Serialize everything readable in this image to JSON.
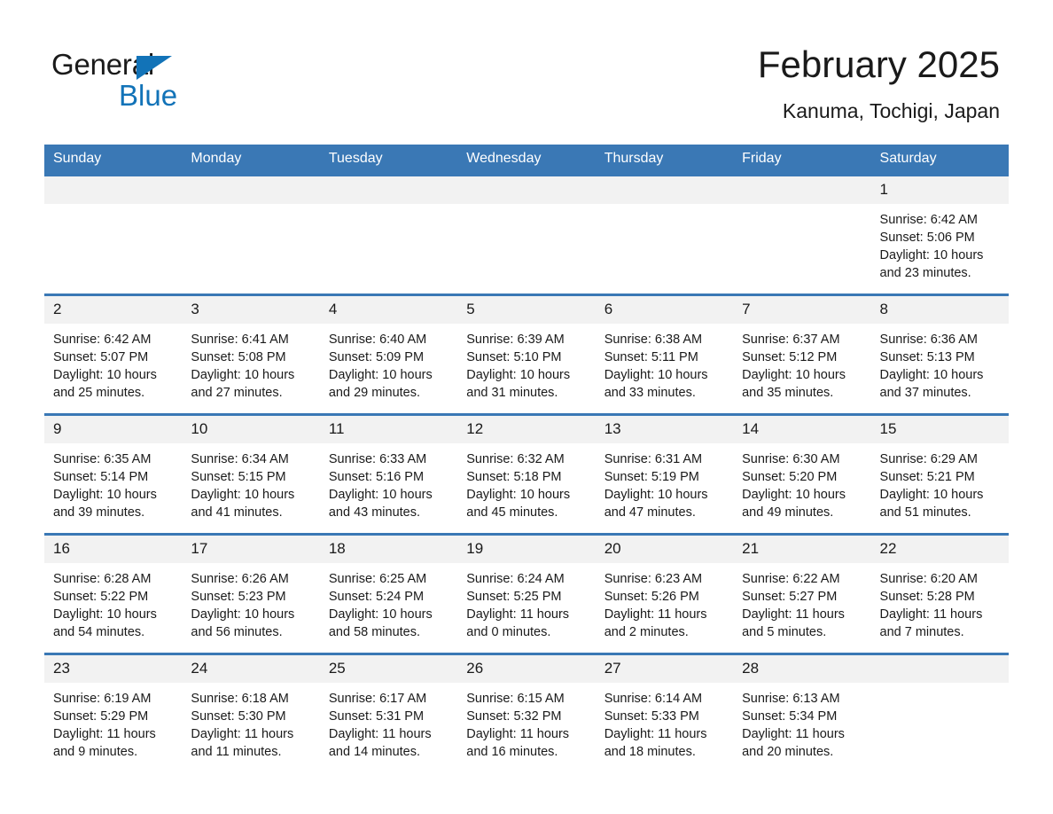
{
  "brand": {
    "word_one": "General",
    "word_two": "Blue",
    "accent_color": "#1273b8",
    "triangle_icon": "brand-triangle-icon"
  },
  "header": {
    "title": "February 2025",
    "subtitle": "Kanuma, Tochigi, Japan"
  },
  "calendar": {
    "header_color": "#3a78b5",
    "daynum_band_color": "#f2f2f2",
    "weekdays": [
      "Sunday",
      "Monday",
      "Tuesday",
      "Wednesday",
      "Thursday",
      "Friday",
      "Saturday"
    ],
    "weeks": [
      [
        {
          "day": "",
          "blank": true
        },
        {
          "day": "",
          "blank": true
        },
        {
          "day": "",
          "blank": true
        },
        {
          "day": "",
          "blank": true
        },
        {
          "day": "",
          "blank": true
        },
        {
          "day": "",
          "blank": true
        },
        {
          "day": "1",
          "sunrise": "Sunrise: 6:42 AM",
          "sunset": "Sunset: 5:06 PM",
          "daylight": "Daylight: 10 hours and 23 minutes."
        }
      ],
      [
        {
          "day": "2",
          "sunrise": "Sunrise: 6:42 AM",
          "sunset": "Sunset: 5:07 PM",
          "daylight": "Daylight: 10 hours and 25 minutes."
        },
        {
          "day": "3",
          "sunrise": "Sunrise: 6:41 AM",
          "sunset": "Sunset: 5:08 PM",
          "daylight": "Daylight: 10 hours and 27 minutes."
        },
        {
          "day": "4",
          "sunrise": "Sunrise: 6:40 AM",
          "sunset": "Sunset: 5:09 PM",
          "daylight": "Daylight: 10 hours and 29 minutes."
        },
        {
          "day": "5",
          "sunrise": "Sunrise: 6:39 AM",
          "sunset": "Sunset: 5:10 PM",
          "daylight": "Daylight: 10 hours and 31 minutes."
        },
        {
          "day": "6",
          "sunrise": "Sunrise: 6:38 AM",
          "sunset": "Sunset: 5:11 PM",
          "daylight": "Daylight: 10 hours and 33 minutes."
        },
        {
          "day": "7",
          "sunrise": "Sunrise: 6:37 AM",
          "sunset": "Sunset: 5:12 PM",
          "daylight": "Daylight: 10 hours and 35 minutes."
        },
        {
          "day": "8",
          "sunrise": "Sunrise: 6:36 AM",
          "sunset": "Sunset: 5:13 PM",
          "daylight": "Daylight: 10 hours and 37 minutes."
        }
      ],
      [
        {
          "day": "9",
          "sunrise": "Sunrise: 6:35 AM",
          "sunset": "Sunset: 5:14 PM",
          "daylight": "Daylight: 10 hours and 39 minutes."
        },
        {
          "day": "10",
          "sunrise": "Sunrise: 6:34 AM",
          "sunset": "Sunset: 5:15 PM",
          "daylight": "Daylight: 10 hours and 41 minutes."
        },
        {
          "day": "11",
          "sunrise": "Sunrise: 6:33 AM",
          "sunset": "Sunset: 5:16 PM",
          "daylight": "Daylight: 10 hours and 43 minutes."
        },
        {
          "day": "12",
          "sunrise": "Sunrise: 6:32 AM",
          "sunset": "Sunset: 5:18 PM",
          "daylight": "Daylight: 10 hours and 45 minutes."
        },
        {
          "day": "13",
          "sunrise": "Sunrise: 6:31 AM",
          "sunset": "Sunset: 5:19 PM",
          "daylight": "Daylight: 10 hours and 47 minutes."
        },
        {
          "day": "14",
          "sunrise": "Sunrise: 6:30 AM",
          "sunset": "Sunset: 5:20 PM",
          "daylight": "Daylight: 10 hours and 49 minutes."
        },
        {
          "day": "15",
          "sunrise": "Sunrise: 6:29 AM",
          "sunset": "Sunset: 5:21 PM",
          "daylight": "Daylight: 10 hours and 51 minutes."
        }
      ],
      [
        {
          "day": "16",
          "sunrise": "Sunrise: 6:28 AM",
          "sunset": "Sunset: 5:22 PM",
          "daylight": "Daylight: 10 hours and 54 minutes."
        },
        {
          "day": "17",
          "sunrise": "Sunrise: 6:26 AM",
          "sunset": "Sunset: 5:23 PM",
          "daylight": "Daylight: 10 hours and 56 minutes."
        },
        {
          "day": "18",
          "sunrise": "Sunrise: 6:25 AM",
          "sunset": "Sunset: 5:24 PM",
          "daylight": "Daylight: 10 hours and 58 minutes."
        },
        {
          "day": "19",
          "sunrise": "Sunrise: 6:24 AM",
          "sunset": "Sunset: 5:25 PM",
          "daylight": "Daylight: 11 hours and 0 minutes."
        },
        {
          "day": "20",
          "sunrise": "Sunrise: 6:23 AM",
          "sunset": "Sunset: 5:26 PM",
          "daylight": "Daylight: 11 hours and 2 minutes."
        },
        {
          "day": "21",
          "sunrise": "Sunrise: 6:22 AM",
          "sunset": "Sunset: 5:27 PM",
          "daylight": "Daylight: 11 hours and 5 minutes."
        },
        {
          "day": "22",
          "sunrise": "Sunrise: 6:20 AM",
          "sunset": "Sunset: 5:28 PM",
          "daylight": "Daylight: 11 hours and 7 minutes."
        }
      ],
      [
        {
          "day": "23",
          "sunrise": "Sunrise: 6:19 AM",
          "sunset": "Sunset: 5:29 PM",
          "daylight": "Daylight: 11 hours and 9 minutes."
        },
        {
          "day": "24",
          "sunrise": "Sunrise: 6:18 AM",
          "sunset": "Sunset: 5:30 PM",
          "daylight": "Daylight: 11 hours and 11 minutes."
        },
        {
          "day": "25",
          "sunrise": "Sunrise: 6:17 AM",
          "sunset": "Sunset: 5:31 PM",
          "daylight": "Daylight: 11 hours and 14 minutes."
        },
        {
          "day": "26",
          "sunrise": "Sunrise: 6:15 AM",
          "sunset": "Sunset: 5:32 PM",
          "daylight": "Daylight: 11 hours and 16 minutes."
        },
        {
          "day": "27",
          "sunrise": "Sunrise: 6:14 AM",
          "sunset": "Sunset: 5:33 PM",
          "daylight": "Daylight: 11 hours and 18 minutes."
        },
        {
          "day": "28",
          "sunrise": "Sunrise: 6:13 AM",
          "sunset": "Sunset: 5:34 PM",
          "daylight": "Daylight: 11 hours and 20 minutes."
        },
        {
          "day": "",
          "blank": true
        }
      ]
    ]
  }
}
